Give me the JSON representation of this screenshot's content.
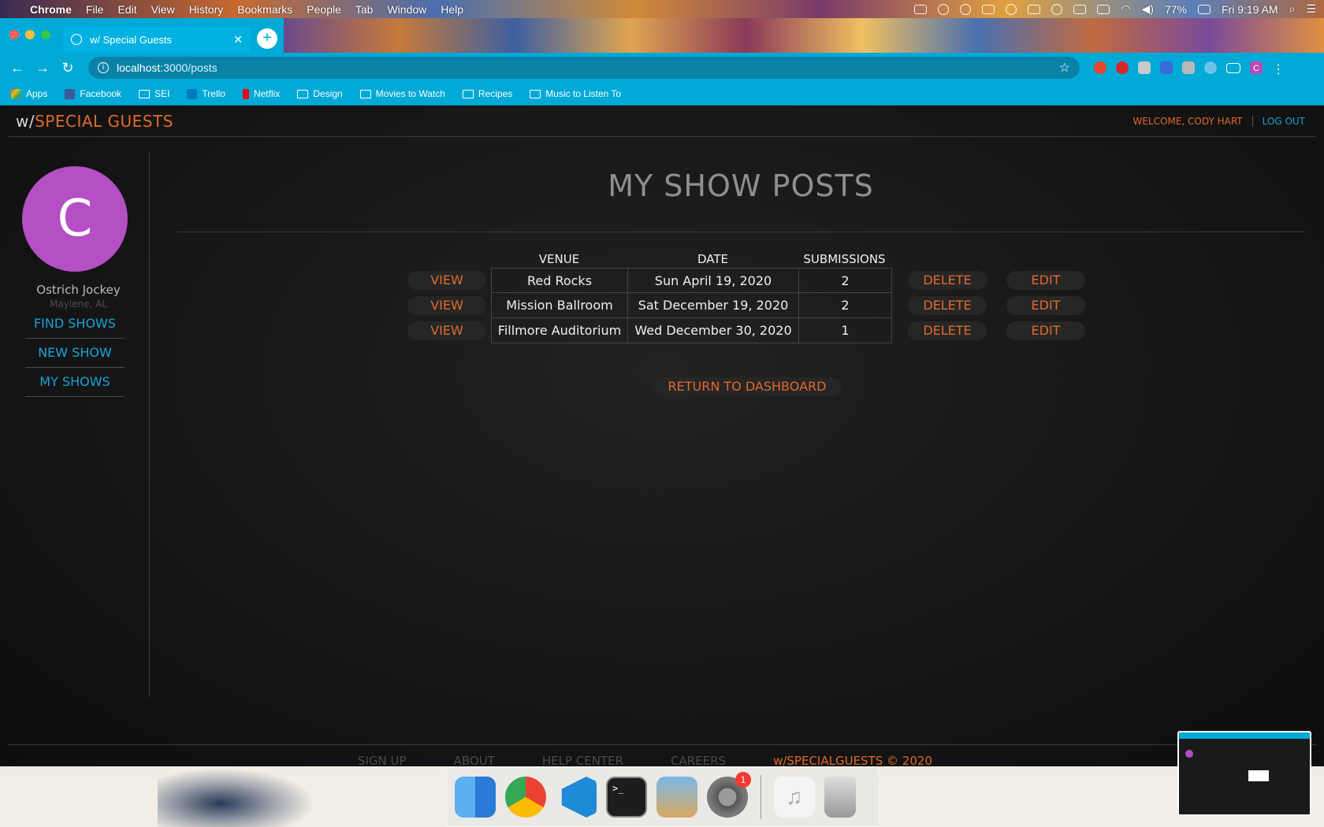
{
  "menubar": {
    "app": "Chrome",
    "items": [
      "File",
      "Edit",
      "View",
      "History",
      "Bookmarks",
      "People",
      "Tab",
      "Window",
      "Help"
    ],
    "battery": "77%",
    "clock": "Fri 9:19 AM"
  },
  "browser": {
    "tab_title": "w/ Special Guests",
    "url_host": "localhost",
    "url_path": ":3000/posts",
    "profile_initial": "C",
    "bookmarks": [
      "Apps",
      "Facebook",
      "SEI",
      "Trello",
      "Netflix",
      "Design",
      "Movies to Watch",
      "Recipes",
      "Music to Listen To"
    ]
  },
  "site": {
    "brand_prefix": "w/",
    "brand_name": "SPECIAL GUESTS",
    "welcome": "WELCOME, CODY HART",
    "logout": "LOG OUT"
  },
  "sidebar": {
    "avatar_initial": "C",
    "username": "Ostrich Jockey",
    "location": "Maylene, AL",
    "links": [
      "FIND SHOWS",
      "NEW SHOW",
      "MY SHOWS"
    ]
  },
  "main": {
    "title": "MY SHOW POSTS",
    "columns": {
      "venue": "VENUE",
      "date": "DATE",
      "submissions": "SUBMISSIONS"
    },
    "view_label": "VIEW",
    "delete_label": "DELETE",
    "edit_label": "EDIT",
    "rows": [
      {
        "venue": "Red Rocks",
        "date": "Sun  April  19, 2020",
        "submissions": "2"
      },
      {
        "venue": "Mission Ballroom",
        "date": "Sat  December  19, 2020",
        "submissions": "2"
      },
      {
        "venue": "Fillmore Auditorium",
        "date": "Wed  December  30, 2020",
        "submissions": "1"
      }
    ],
    "return_label": "RETURN TO DASHBOARD"
  },
  "footer": {
    "links": [
      "SIGN UP",
      "ABOUT",
      "HELP CENTER",
      "CAREERS"
    ],
    "copyright": "w/SPECIALGUESTS © 2020"
  },
  "dock": {
    "badge_count": "1"
  }
}
